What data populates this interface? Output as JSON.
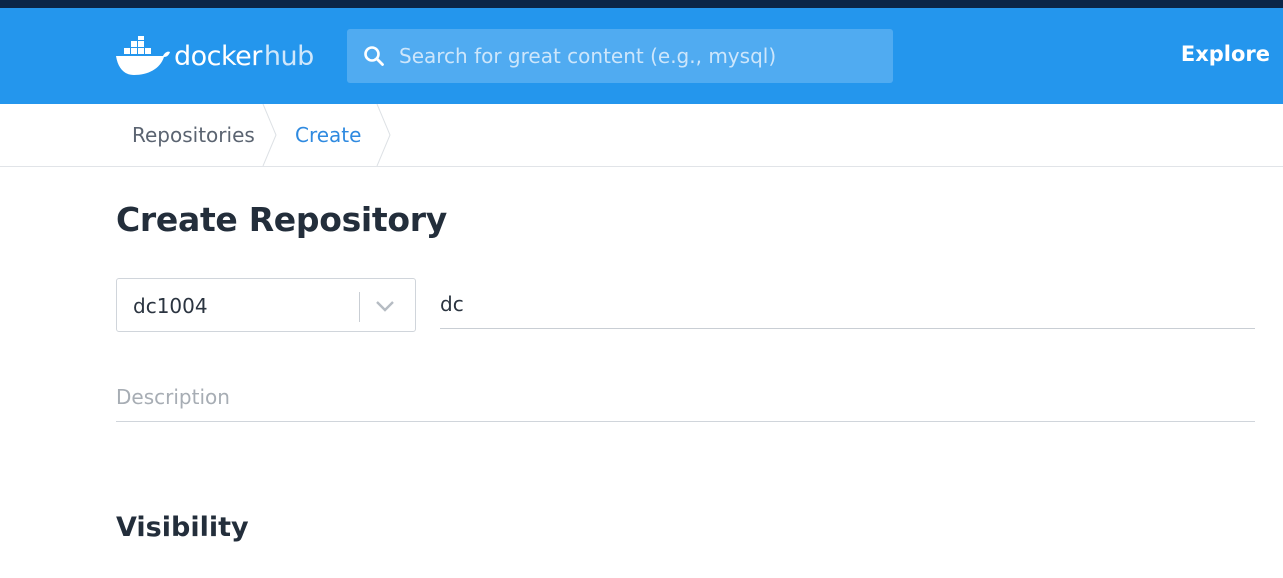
{
  "header": {
    "brand_docker": "docker",
    "brand_hub": "hub",
    "search_placeholder": "Search for great content (e.g., mysql)",
    "explore_label": "Explore",
    "colors": {
      "navbar": "#2496ed",
      "top_strip": "#0b2547",
      "search_bg": "#50abf1"
    }
  },
  "breadcrumb": {
    "items": [
      {
        "label": "Repositories"
      },
      {
        "label": "Create"
      }
    ]
  },
  "main": {
    "title": "Create Repository",
    "namespace_value": "dc1004",
    "name_value": "dc",
    "description_placeholder": "Description",
    "visibility_heading": "Visibility"
  },
  "icons": [
    "docker-whale-logo-icon",
    "search-icon",
    "chevron-down-icon",
    "breadcrumb-separator-icon"
  ]
}
